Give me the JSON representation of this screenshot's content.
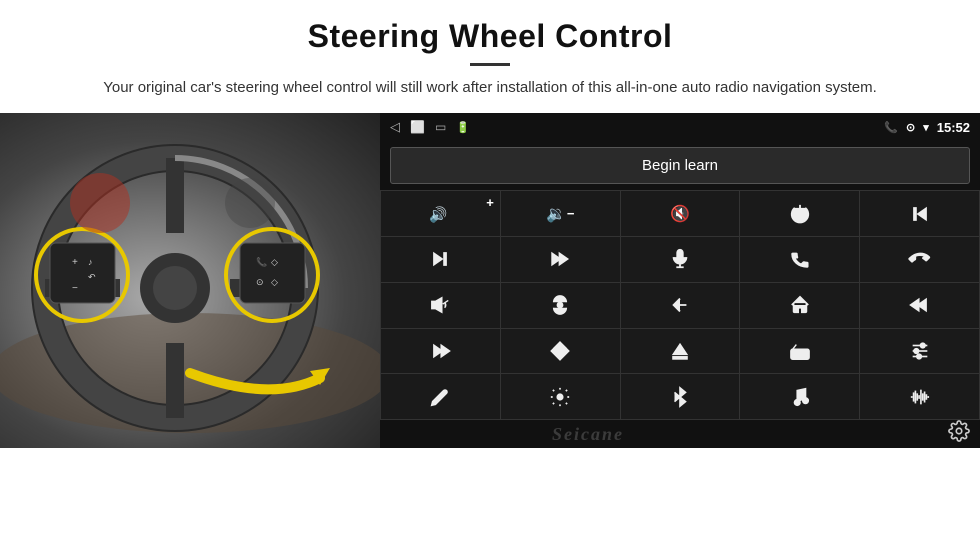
{
  "header": {
    "title": "Steering Wheel Control",
    "divider": true,
    "description": "Your original car's steering wheel control will still work after installation of this all-in-one auto radio navigation system."
  },
  "status_bar": {
    "nav_back": "◁",
    "nav_home": "⬜",
    "nav_recents": "▭",
    "status_icons": "📶",
    "time": "15:52",
    "phone_icon": "📞",
    "location_icon": "⊙",
    "wifi_icon": "▾"
  },
  "begin_learn": {
    "label": "Begin learn"
  },
  "controls": [
    {
      "icon": "vol_up",
      "sym": "🔊+"
    },
    {
      "icon": "vol_down",
      "sym": "🔉−"
    },
    {
      "icon": "mute",
      "sym": "🔇"
    },
    {
      "icon": "power",
      "sym": "⏻"
    },
    {
      "icon": "skip_prev",
      "sym": "⏮"
    },
    {
      "icon": "next_track",
      "sym": "⏭"
    },
    {
      "icon": "ff_skip",
      "sym": "⏩"
    },
    {
      "icon": "mic",
      "sym": "🎙"
    },
    {
      "icon": "phone",
      "sym": "📞"
    },
    {
      "icon": "hang_up",
      "sym": "↩"
    },
    {
      "icon": "horn",
      "sym": "📣"
    },
    {
      "icon": "360_view",
      "sym": "⊙"
    },
    {
      "icon": "back",
      "sym": "↩"
    },
    {
      "icon": "home",
      "sym": "⌂"
    },
    {
      "icon": "skip_back2",
      "sym": "⏮"
    },
    {
      "icon": "fast_fwd",
      "sym": "⏩"
    },
    {
      "icon": "nav",
      "sym": "➤"
    },
    {
      "icon": "eject",
      "sym": "⏏"
    },
    {
      "icon": "radio",
      "sym": "📻"
    },
    {
      "icon": "eq",
      "sym": "🎚"
    },
    {
      "icon": "pen",
      "sym": "✏"
    },
    {
      "icon": "settings2",
      "sym": "⚙"
    },
    {
      "icon": "bluetooth",
      "sym": "⚡"
    },
    {
      "icon": "music",
      "sym": "🎵"
    },
    {
      "icon": "waveform",
      "sym": "📊"
    }
  ],
  "branding": {
    "name": "Seicane"
  },
  "gear": "⚙"
}
